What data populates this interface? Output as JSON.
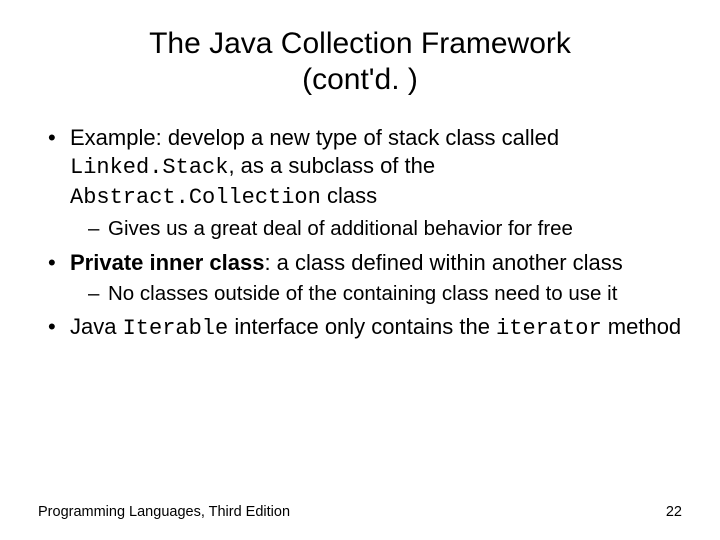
{
  "title_line1": "The Java Collection Framework",
  "title_line2": "(cont'd. )",
  "b1_pre": "Example: develop a new type of stack class called ",
  "b1_code1": "Linked.Stack",
  "b1_mid": ", as a subclass of the ",
  "b1_code2": "Abstract.Collection",
  "b1_post": " class",
  "b1_sub1": "Gives us a great deal of additional behavior for free",
  "b2_bold": "Private inner class",
  "b2_rest": ": a class defined within another class",
  "b2_sub1": "No classes outside of the containing class need to use it",
  "b3_pre": "Java ",
  "b3_code1": "Iterable",
  "b3_mid": " interface only contains the ",
  "b3_code2": "iterator",
  "b3_post": " method",
  "footer_left": "Programming Languages, Third Edition",
  "footer_right": "22"
}
